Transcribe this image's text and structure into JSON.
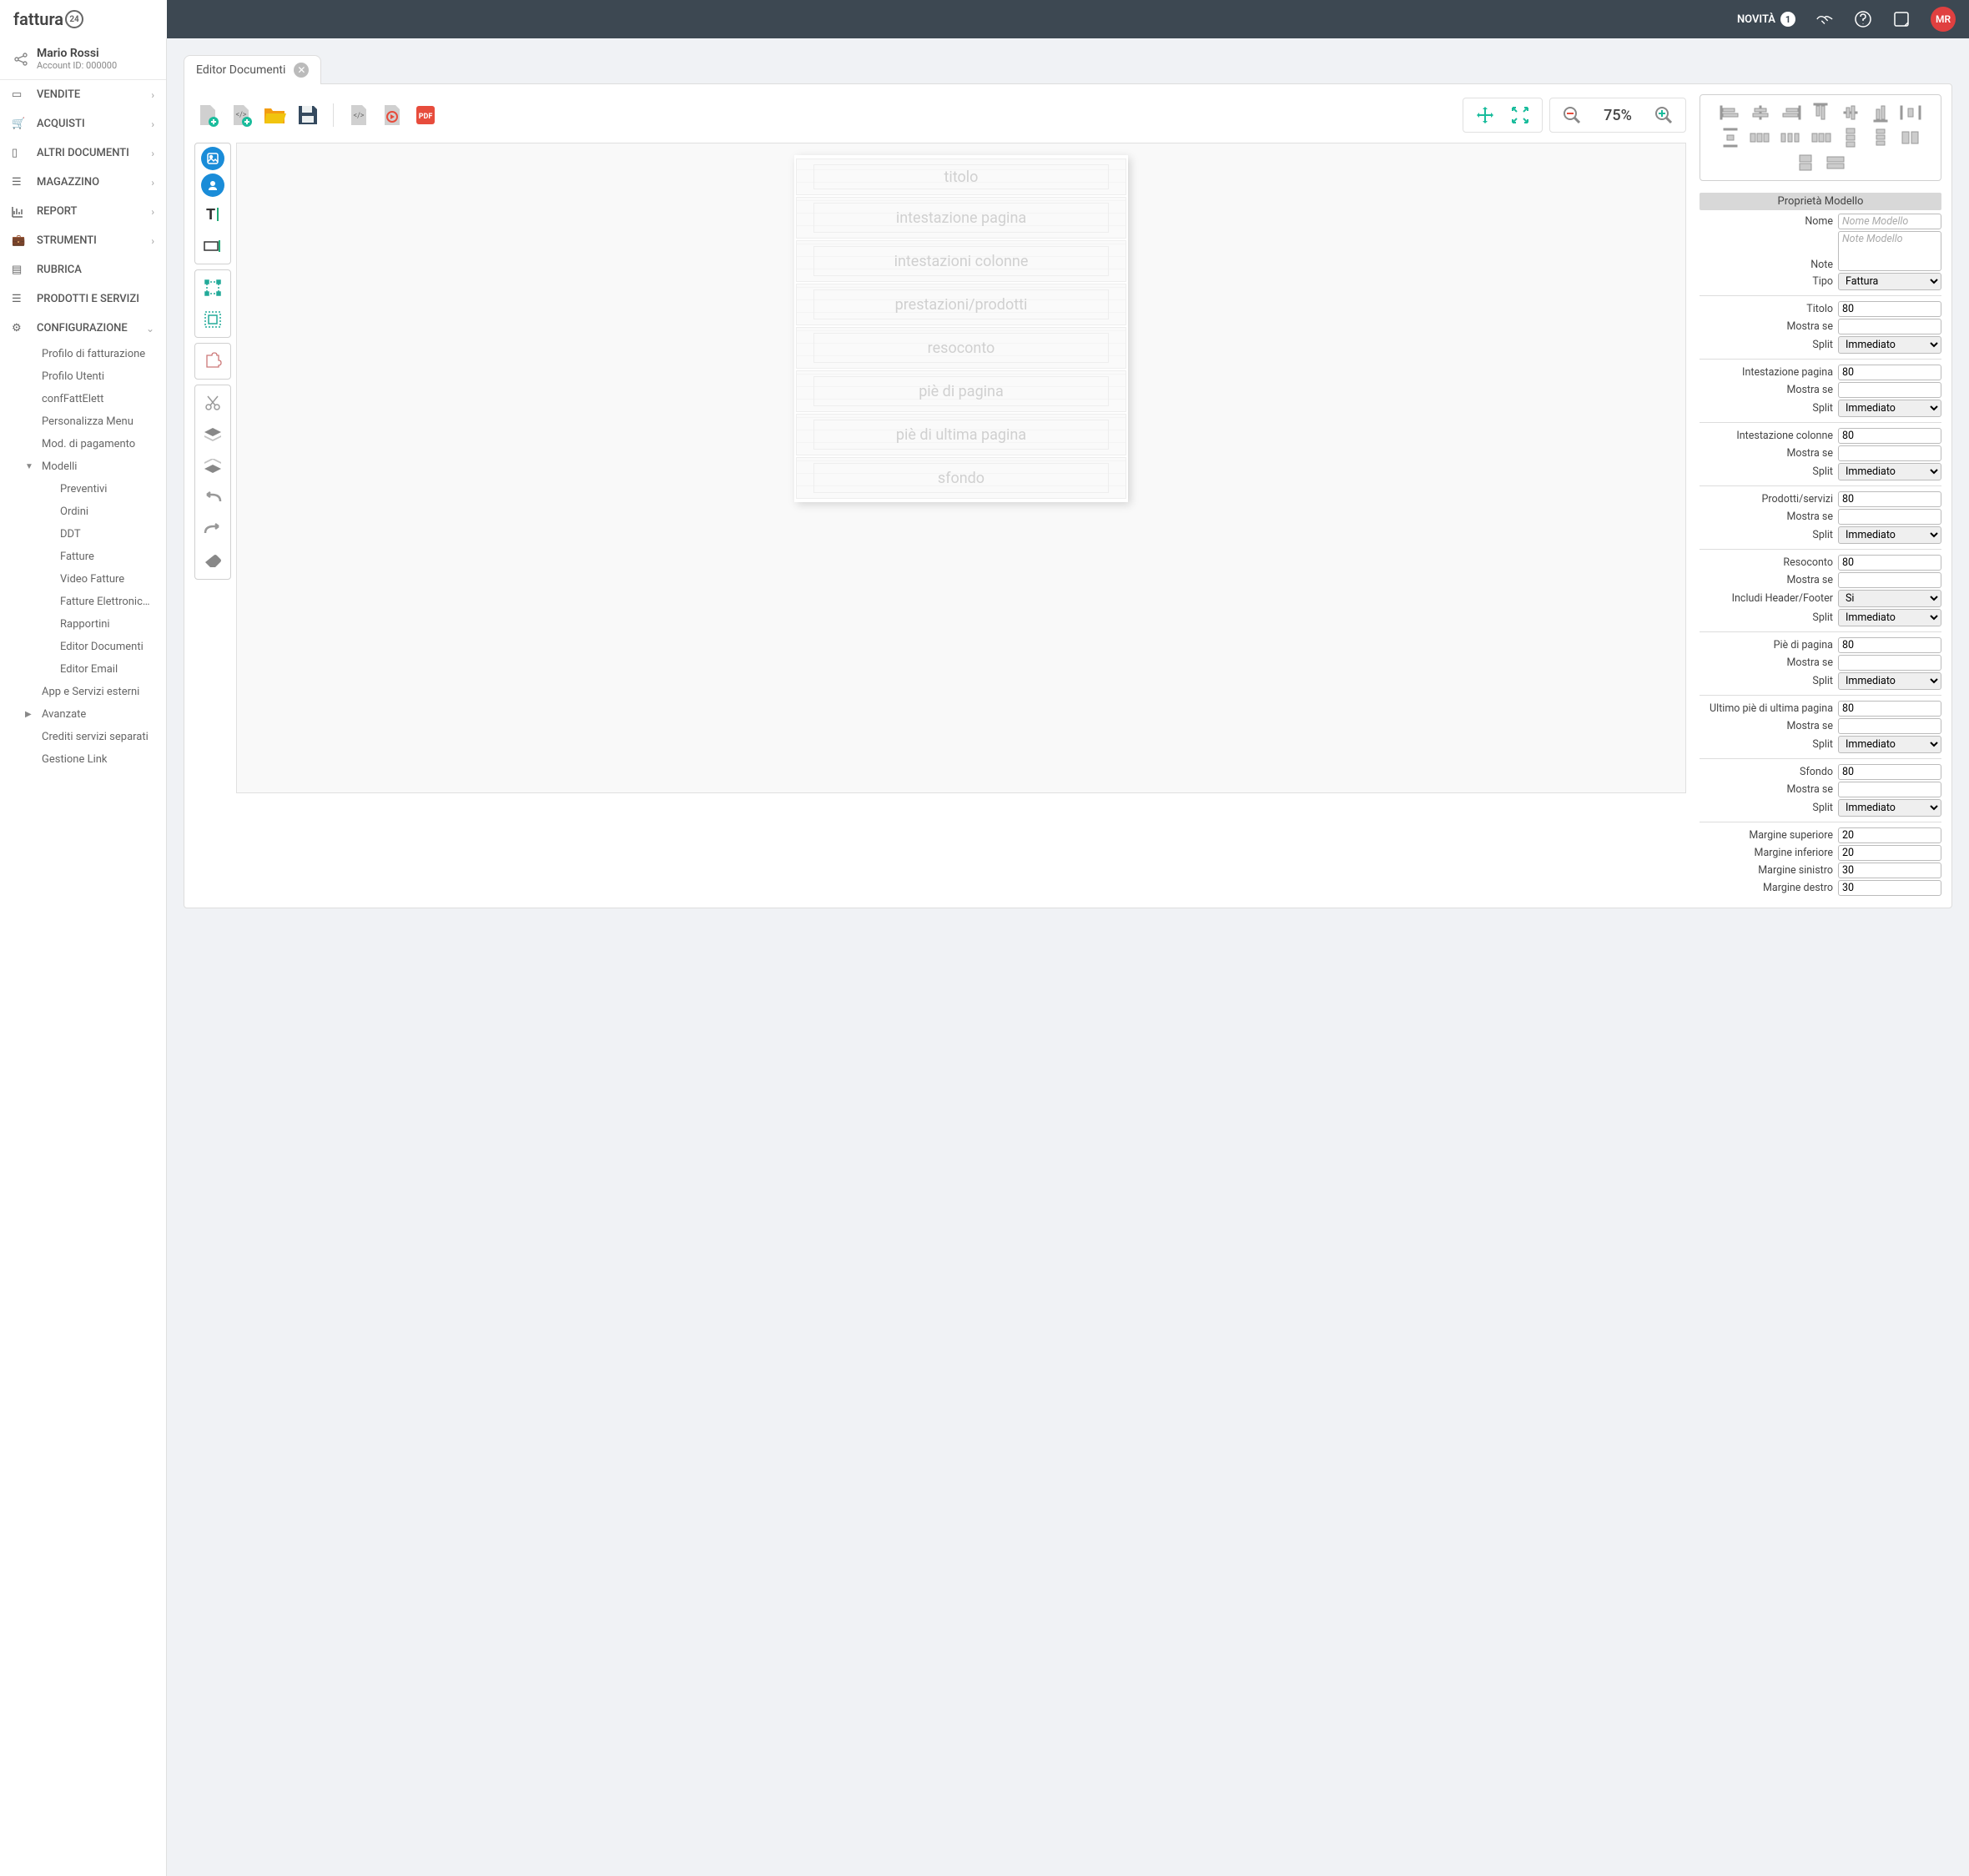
{
  "header": {
    "logo": "fattura",
    "logo_suffix": "24",
    "novita_label": "NOVITÀ",
    "novita_count": "1",
    "avatar_initials": "MR"
  },
  "user": {
    "name": "Mario Rossi",
    "account": "Account ID: 000000"
  },
  "nav": {
    "vendite": "VENDITE",
    "acquisti": "ACQUISTI",
    "altri": "ALTRI DOCUMENTI",
    "magazzino": "MAGAZZINO",
    "report": "REPORT",
    "strumenti": "STRUMENTI",
    "rubrica": "RUBRICA",
    "prodotti": "PRODOTTI E SERVIZI",
    "config": "CONFIGURAZIONE",
    "config_items": {
      "profilo_fatt": "Profilo di fatturazione",
      "profilo_utenti": "Profilo Utenti",
      "conf_fatt": "confFattElett",
      "personalizza": "Personalizza Menu",
      "mod_pagamento": "Mod. di pagamento",
      "modelli": "Modelli",
      "preventivi": "Preventivi",
      "ordini": "Ordini",
      "ddt": "DDT",
      "fatture": "Fatture",
      "video_fatture": "Video Fatture",
      "fatture_el": "Fatture Elettronic…",
      "rapportini": "Rapportini",
      "editor_doc": "Editor Documenti",
      "editor_email": "Editor Email",
      "app_servizi": "App e Servizi esterni",
      "avanzate": "Avanzate",
      "crediti": "Crediti servizi separati",
      "gestione_link": "Gestione Link"
    }
  },
  "tab": {
    "title": "Editor Documenti"
  },
  "zoom": {
    "value": "75%"
  },
  "page_sections": {
    "titolo": "titolo",
    "intestazione_pagina": "intestazione pagina",
    "intestazioni_colonne": "intestazioni colonne",
    "prestazioni": "prestazioni/prodotti",
    "resoconto": "resoconto",
    "pie_pagina": "piè di pagina",
    "pie_ultima": "piè di ultima pagina",
    "sfondo": "sfondo"
  },
  "props": {
    "header": "Proprietà Modello",
    "labels": {
      "nome": "Nome",
      "note": "Note",
      "tipo": "Tipo",
      "titolo": "Titolo",
      "mostra_se": "Mostra se",
      "split": "Split",
      "intestazione_pagina": "Intestazione pagina",
      "intestazione_colonne": "Intestazione colonne",
      "prodotti": "Prodotti/servizi",
      "resoconto": "Resoconto",
      "includi_hf": "Includi Header/Footer",
      "pie_pagina": "Piè di pagina",
      "ultimo_pie": "Ultimo piè di ultima pagina",
      "sfondo": "Sfondo",
      "margine_sup": "Margine superiore",
      "margine_inf": "Margine inferiore",
      "margine_sin": "Margine sinistro",
      "margine_des": "Margine destro"
    },
    "placeholders": {
      "nome": "Nome Modello",
      "note": "Note Modello"
    },
    "values": {
      "tipo": "Fattura",
      "titolo": "80",
      "intestazione_pagina": "80",
      "intestazione_colonne": "80",
      "prodotti": "80",
      "resoconto": "80",
      "pie_pagina": "80",
      "ultimo_pie": "80",
      "sfondo": "80",
      "includi_hf": "Si",
      "split": "Immediato",
      "margine_sup": "20",
      "margine_inf": "20",
      "margine_sin": "30",
      "margine_des": "30"
    }
  }
}
